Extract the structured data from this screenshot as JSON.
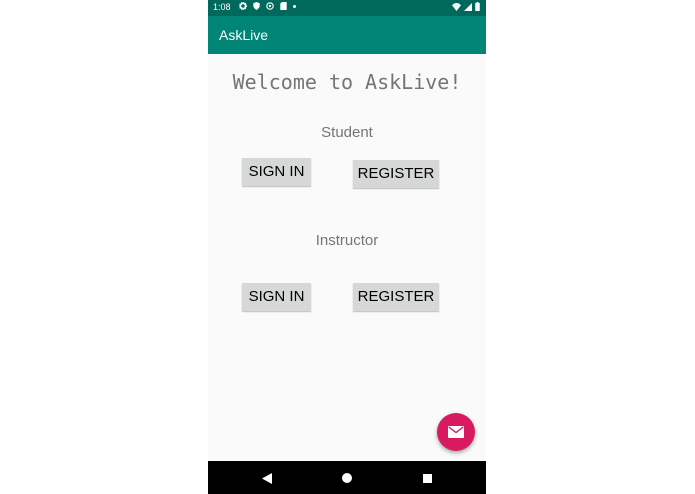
{
  "status_bar": {
    "time": "1:08",
    "left_icons": [
      "gear-icon",
      "shield-icon",
      "sync-icon",
      "sd-card-icon",
      "dot-icon"
    ],
    "right_icons": [
      "wifi-icon",
      "signal-icon",
      "battery-icon"
    ]
  },
  "app_bar": {
    "title": "AskLive"
  },
  "welcome": "Welcome to AskLive!",
  "student": {
    "label": "Student",
    "sign_in": "SIGN IN",
    "register": "REGISTER"
  },
  "instructor": {
    "label": "Instructor",
    "sign_in": "SIGN IN",
    "register": "REGISTER"
  },
  "fab": {
    "icon": "mail-icon"
  },
  "nav_bar": {
    "icons": [
      "back-icon",
      "home-icon",
      "recents-icon"
    ]
  },
  "colors": {
    "status_bar": "#00695c",
    "app_bar": "#008577",
    "fab": "#d81b60",
    "button": "#d6d7d7",
    "text_gray": "#757575"
  }
}
